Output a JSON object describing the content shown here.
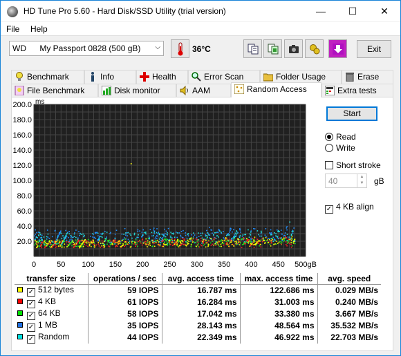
{
  "window": {
    "title": "HD Tune Pro 5.60 - Hard Disk/SSD Utility (trial version)",
    "minimize": "—",
    "maximize": "☐",
    "close": "✕"
  },
  "menu": {
    "file": "File",
    "help": "Help"
  },
  "toolbar": {
    "drive_brand": "WD",
    "drive_name": "My Passport 0828 (500 gB)",
    "temperature": "36°C",
    "exit": "Exit"
  },
  "tabs_row1": [
    "Benchmark",
    "Info",
    "Health",
    "Error Scan",
    "Folder Usage",
    "Erase"
  ],
  "tabs_row2": [
    "File Benchmark",
    "Disk monitor",
    "AAM",
    "Random Access",
    "Extra tests"
  ],
  "active_tab": "Random Access",
  "side": {
    "start": "Start",
    "read": "Read",
    "write": "Write",
    "short_stroke": "Short stroke",
    "stroke_value": "40",
    "stroke_unit": "gB",
    "align": "4 KB align"
  },
  "chart_data": {
    "type": "scatter",
    "ylabel": "ms",
    "ylim": [
      0,
      200
    ],
    "xlim": [
      0,
      500
    ],
    "y_ticks": [
      "200.0",
      "180.0",
      "160.0",
      "140.0",
      "120.0",
      "100.0",
      "80.0",
      "60.0",
      "40.0",
      "20.0"
    ],
    "x_ticks": [
      "0",
      "50",
      "100",
      "150",
      "200",
      "250",
      "300",
      "350",
      "400",
      "450",
      "500gB"
    ],
    "grid": true,
    "series_colors": [
      "#ffff00",
      "#ff2020",
      "#20e020",
      "#2090ff",
      "#20e0e0"
    ],
    "series_ranges_ms": [
      [
        12,
        22
      ],
      [
        12,
        22
      ],
      [
        13,
        22
      ],
      [
        20,
        36
      ],
      [
        16,
        32
      ]
    ]
  },
  "results": {
    "headers": [
      "transfer size",
      "operations / sec",
      "avg. access time",
      "max. access time",
      "avg. speed"
    ],
    "rows": [
      {
        "color": "#ffff00",
        "size": "512 bytes",
        "ops": "59 IOPS",
        "avg": "16.787 ms",
        "max": "122.686 ms",
        "speed": "0.029 MB/s"
      },
      {
        "color": "#ff0000",
        "size": "4 KB",
        "ops": "61 IOPS",
        "avg": "16.284 ms",
        "max": "31.003 ms",
        "speed": "0.240 MB/s"
      },
      {
        "color": "#00e000",
        "size": "64 KB",
        "ops": "58 IOPS",
        "avg": "17.042 ms",
        "max": "33.380 ms",
        "speed": "3.667 MB/s"
      },
      {
        "color": "#1e6ee0",
        "size": "1 MB",
        "ops": "35 IOPS",
        "avg": "28.143 ms",
        "max": "48.564 ms",
        "speed": "35.532 MB/s"
      },
      {
        "color": "#00e0e0",
        "size": "Random",
        "ops": "44 IOPS",
        "avg": "22.349 ms",
        "max": "46.922 ms",
        "speed": "22.703 MB/s"
      }
    ]
  }
}
